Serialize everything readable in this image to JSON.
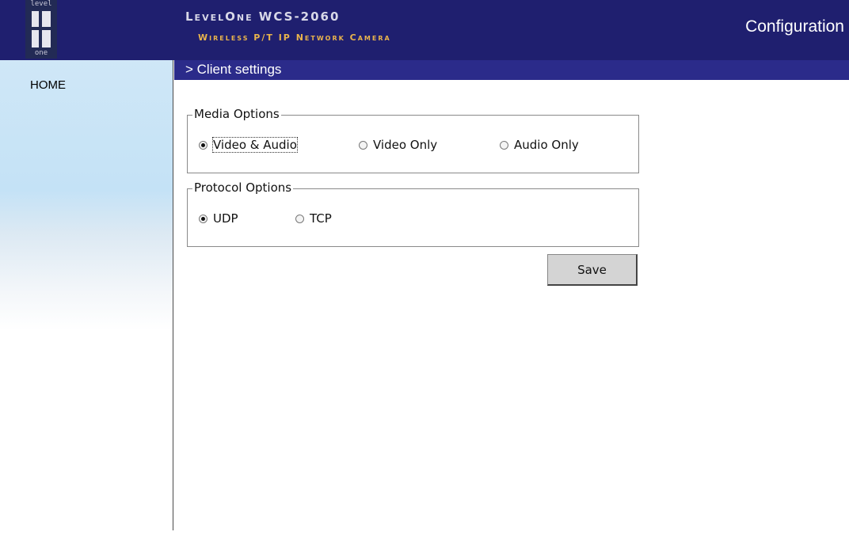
{
  "header": {
    "logo_top": "level",
    "logo_bottom": "one",
    "brand_title": "LevelOne WCS-2060",
    "brand_subtitle": "Wireless P/T IP Network Camera",
    "page_mode": "Configuration"
  },
  "sidebar": {
    "items": [
      {
        "label": "HOME"
      }
    ]
  },
  "main": {
    "section_title": "> Client settings",
    "media_options": {
      "legend": "Media Options",
      "options": [
        {
          "label": "Video & Audio",
          "selected": true
        },
        {
          "label": "Video Only",
          "selected": false
        },
        {
          "label": "Audio Only",
          "selected": false
        }
      ]
    },
    "protocol_options": {
      "legend": "Protocol Options",
      "options": [
        {
          "label": "UDP",
          "selected": true
        },
        {
          "label": "TCP",
          "selected": false
        }
      ]
    },
    "save_label": "Save"
  },
  "colors": {
    "header_bg": "#1f1f6f",
    "section_bar_bg": "#2b2b8a",
    "brand_subtitle": "#e9b44c",
    "sidebar_bg": "#c4e2f6"
  }
}
